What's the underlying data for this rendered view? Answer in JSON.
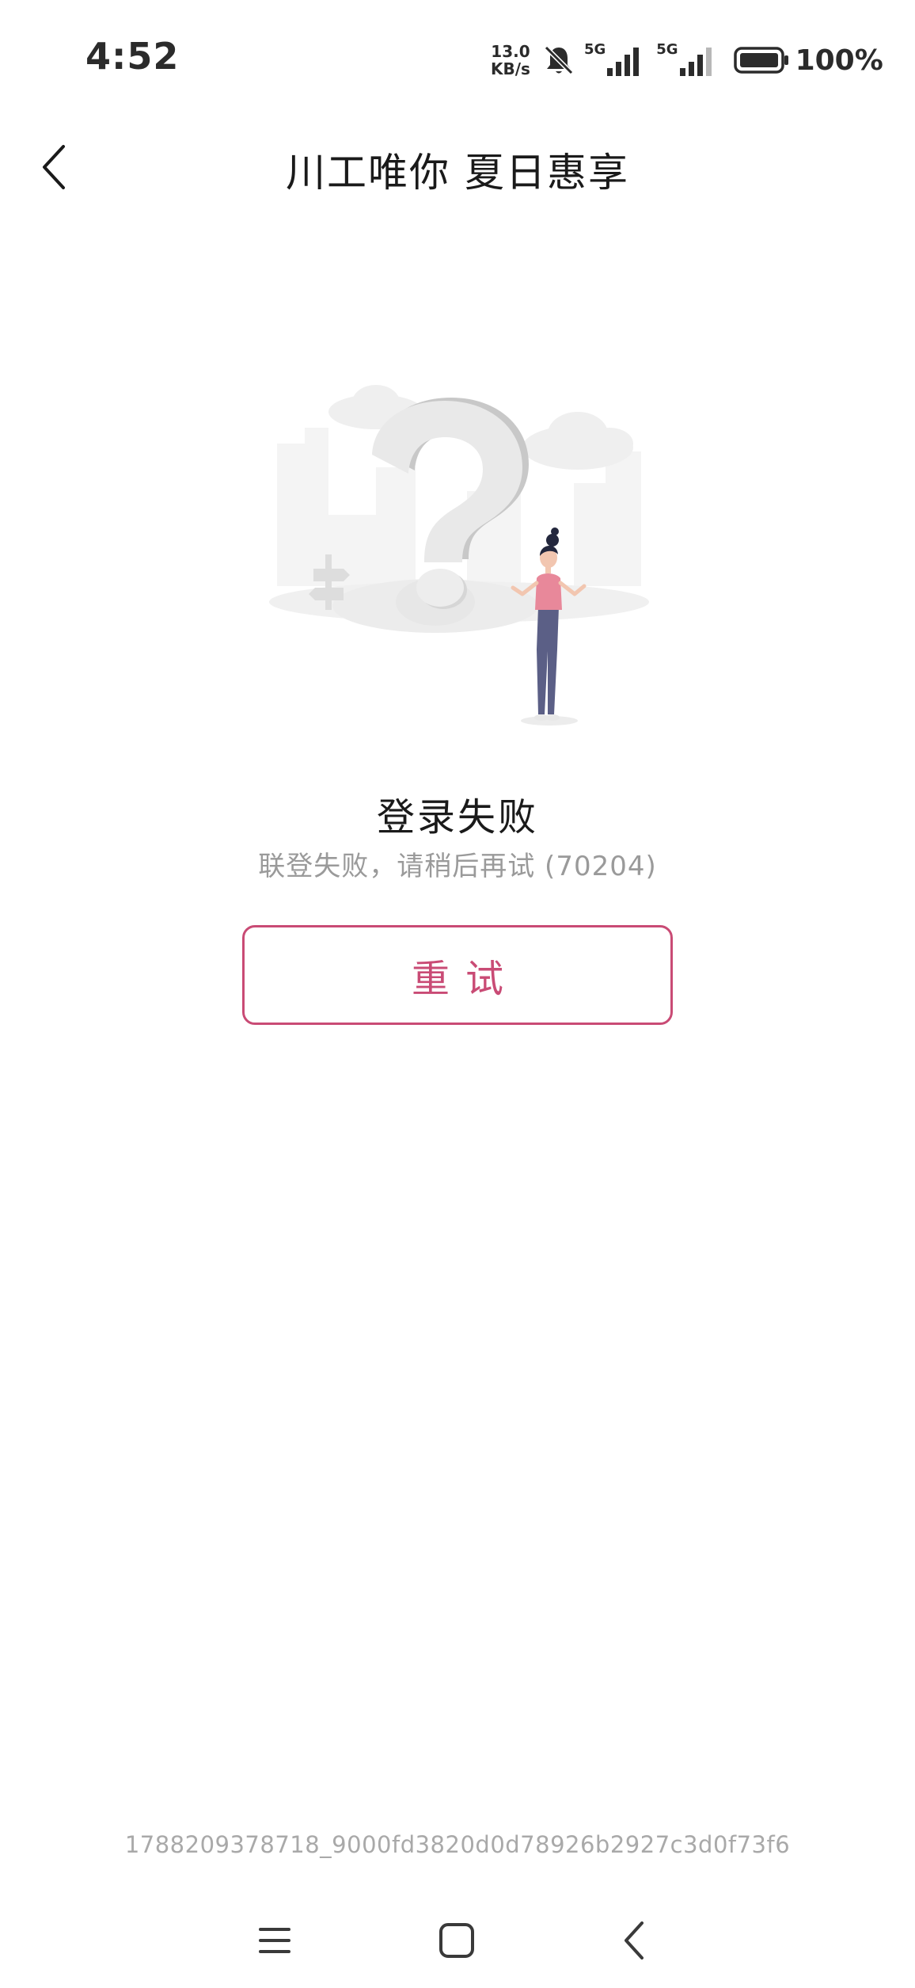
{
  "status_bar": {
    "time": "4:52",
    "net_speed_value": "13.0",
    "net_speed_unit": "KB/s",
    "sim1_label": "5G",
    "sim2_label": "5G",
    "battery_text": "100%",
    "icons": [
      "bell-mute-icon",
      "signal-icon",
      "battery-icon"
    ]
  },
  "header": {
    "title": "川工唯你 夏日惠享",
    "back_icon": "chevron-left-icon"
  },
  "main": {
    "illustration": "question-mark-illustration",
    "error_title": "登录失败",
    "error_description": "联登失败，请稍后再试 (70204)",
    "retry_label": "重试"
  },
  "footer": {
    "trace_id": "1788209378718_9000fd3820d0d78926b2927c3d0f73f6"
  },
  "nav_bar": {
    "icons": [
      "menu-icon",
      "home-square-icon",
      "back-chevron-icon"
    ]
  },
  "colors": {
    "accent": "#c94b75",
    "secondary_text": "#9a9a9a",
    "trace_text": "#a9a9a9"
  }
}
